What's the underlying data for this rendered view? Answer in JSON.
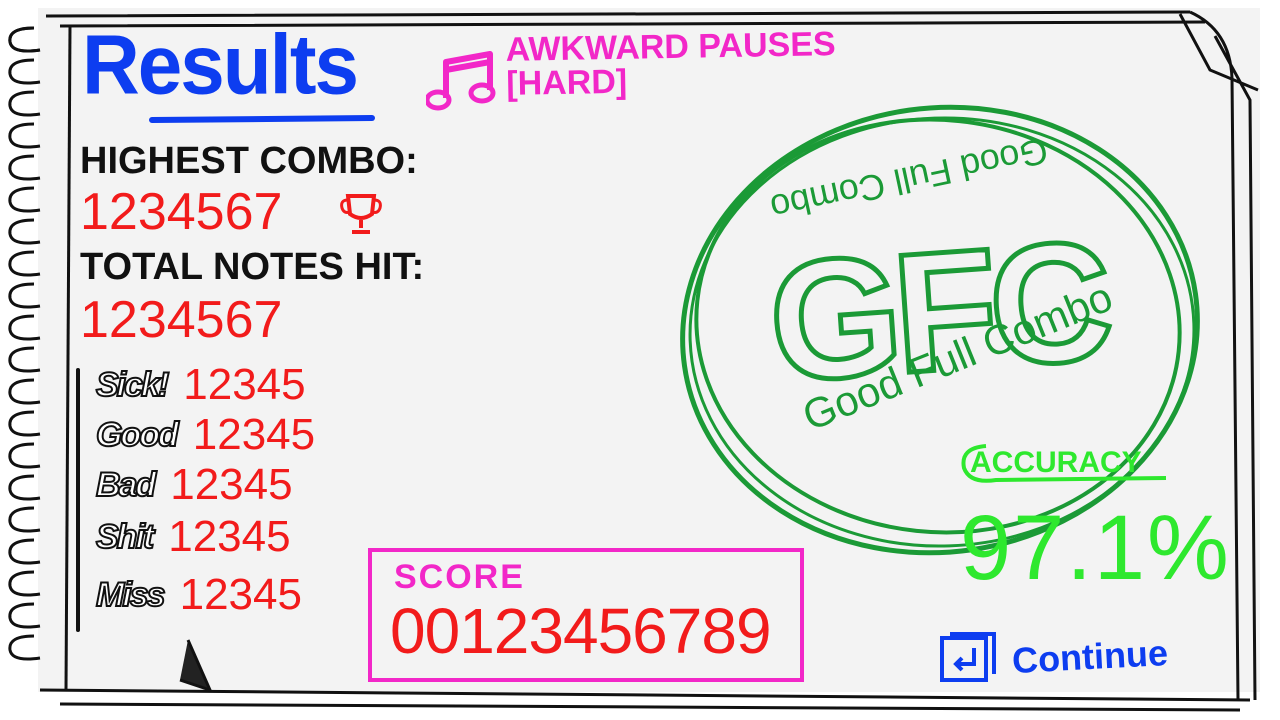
{
  "results": {
    "title": "Results",
    "song": {
      "name": "Awkward Pauses",
      "difficulty": "[Hard]"
    },
    "highest_combo": {
      "label": "Highest Combo:",
      "value": "1234567"
    },
    "total_notes": {
      "label": "Total Notes Hit:",
      "value": "1234567"
    },
    "judgements": [
      {
        "label": "Sick!",
        "value": "12345"
      },
      {
        "label": "Good",
        "value": "12345"
      },
      {
        "label": "Bad",
        "value": "12345"
      },
      {
        "label": "Shit",
        "value": "12345"
      },
      {
        "label": "Miss",
        "value": "12345"
      }
    ],
    "score": {
      "label": "Score",
      "value": "00123456789"
    },
    "rank": {
      "grade": "GFC",
      "subtitle": "Good Full Combo"
    },
    "accuracy": {
      "label": "Accuracy",
      "value": "97.1%"
    },
    "continue_label": "Continue"
  },
  "colors": {
    "title": "#0d3df0",
    "song": "#f227c8",
    "values": "#f21b1b",
    "rank": "#1b9a36",
    "accuracy": "#2ee82e"
  },
  "icons": [
    "music-note-icon",
    "trophy-icon",
    "enter-key-icon"
  ]
}
